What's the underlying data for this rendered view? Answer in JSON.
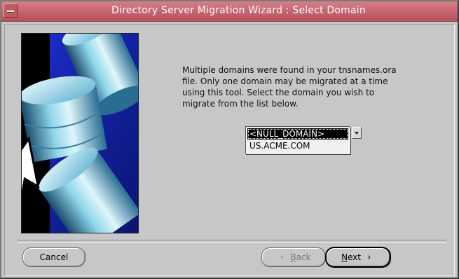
{
  "window": {
    "title": "Directory Server Migration Wizard : Select Domain",
    "system_menu_icon": "window-menu-icon"
  },
  "content": {
    "message": "Multiple domains were found in your tnsnames.ora\nfile. Only one domain may be migrated at a time\nusing this tool. Select the domain you wish to\nmigrate from the list below."
  },
  "domain_select": {
    "options": [
      "<NULL_DOMAIN>",
      "US.ACME.COM"
    ],
    "selected": "<NULL_DOMAIN>",
    "expand_icon": "chevron-down-icon"
  },
  "buttons": {
    "cancel": "Cancel",
    "back_accel": "B",
    "back_rest": "ack",
    "back_icon": "back-arrow-icon",
    "next_accel": "N",
    "next_rest": "ext",
    "next_icon": "next-arrow-icon"
  },
  "colors": {
    "titlebar": "#c0626b",
    "window_bg": "#c6c7c8",
    "selection": "#000000",
    "art_blue": "#1c2fd0"
  },
  "illustration": {
    "icon": "cylinders-cursor-illustration"
  }
}
